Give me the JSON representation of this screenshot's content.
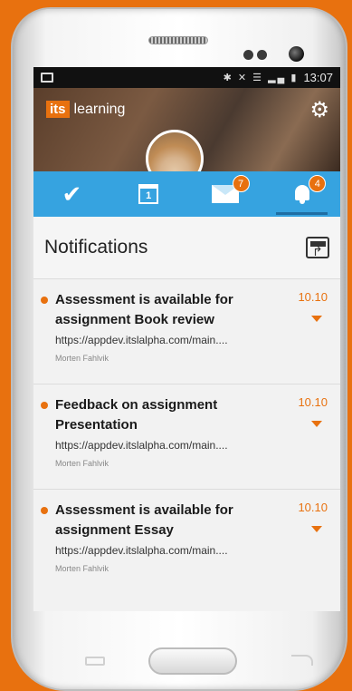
{
  "status_bar": {
    "time": "13:07",
    "icons": "✱ ✕ ☰ ▂▄ ▮"
  },
  "banner": {
    "logo_box": "its",
    "logo_text": "learning",
    "settings_icon": "gear-icon"
  },
  "tabs": [
    {
      "name": "tasks",
      "icon": "checkmark-icon",
      "badge": ""
    },
    {
      "name": "calendar",
      "icon": "calendar-icon",
      "cal_day": "1",
      "badge": ""
    },
    {
      "name": "messages",
      "icon": "envelope-icon",
      "badge": "7"
    },
    {
      "name": "notifications",
      "icon": "bell-icon",
      "badge": "4",
      "active": true
    }
  ],
  "header": {
    "title": "Notifications",
    "share_icon": "share-icon"
  },
  "notifications": [
    {
      "title": "Assessment is available for assignment Book review",
      "date": "10.10",
      "url": "https://appdev.itslalpha.com/main....",
      "author": "Morten Fahlvik"
    },
    {
      "title": "Feedback on assignment Presentation",
      "date": "10.10",
      "url": "https://appdev.itslalpha.com/main....",
      "author": "Morten Fahlvik"
    },
    {
      "title": "Assessment is available for assignment Essay",
      "date": "10.10",
      "url": "https://appdev.itslalpha.com/main....",
      "author": "Morten Fahlvik"
    }
  ],
  "colors": {
    "accent": "#e8710f",
    "tabbar": "#36a3e0",
    "background": "#e8710f"
  }
}
